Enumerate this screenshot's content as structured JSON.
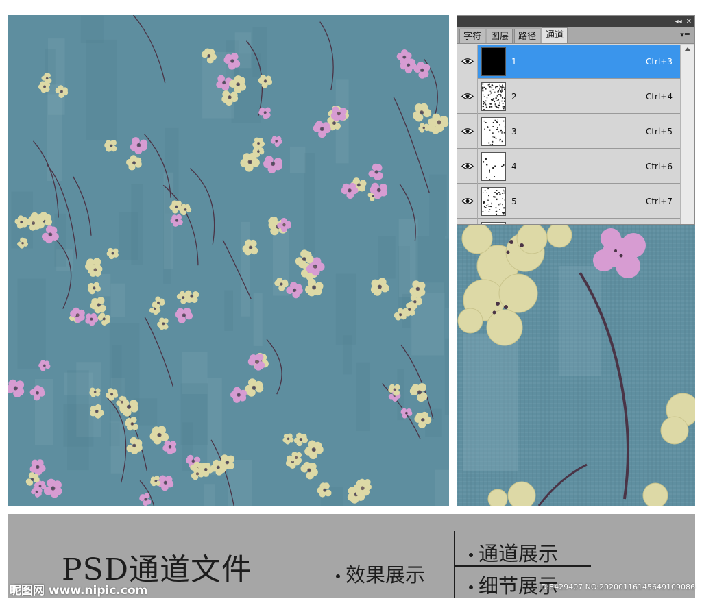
{
  "panel": {
    "titlebar": {
      "collapse_icon": "double-chevron-right-icon",
      "close_icon": "close-icon",
      "collapse_glyph": "◂◂",
      "close_glyph": "✕"
    },
    "tabs": [
      {
        "label": "字符",
        "active": false
      },
      {
        "label": "图层",
        "active": false
      },
      {
        "label": "路径",
        "active": false
      },
      {
        "label": "通道",
        "active": true
      }
    ],
    "menu_icon": "panel-menu-icon",
    "menu_glyph": "▾≡",
    "channels": [
      {
        "name": "1",
        "shortcut": "Ctrl+3",
        "selected": true,
        "thumb": "black"
      },
      {
        "name": "2",
        "shortcut": "Ctrl+4",
        "selected": false,
        "thumb": "dense"
      },
      {
        "name": "3",
        "shortcut": "Ctrl+5",
        "selected": false,
        "thumb": "medium"
      },
      {
        "name": "4",
        "shortcut": "Ctrl+6",
        "selected": false,
        "thumb": "sparse"
      },
      {
        "name": "5",
        "shortcut": "Ctrl+7",
        "selected": false,
        "thumb": "medium"
      }
    ],
    "eye_icon": "eye-icon"
  },
  "colors": {
    "background_teal": "#5e8e9f",
    "flower_yellow": "#ddd9a6",
    "flower_pink": "#d79cd2",
    "branch": "#4a3446",
    "selection_blue": "#3a95ec",
    "caption_gray": "#a6a6a6"
  },
  "caption": {
    "title": "PSD通道文件",
    "effect": "效果展示",
    "channel_display": "通道展示",
    "detail_display": "细节展示"
  },
  "watermark": {
    "site": "昵图网 www.nipic.com",
    "image_id": "ID:8429407 NO:20200116145649109086"
  }
}
